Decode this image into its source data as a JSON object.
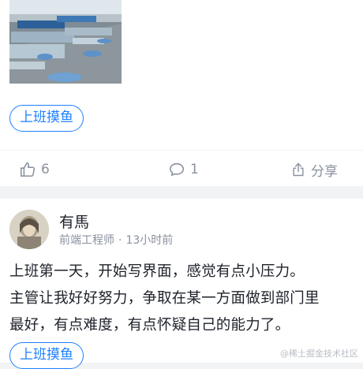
{
  "post1": {
    "tag": "上班摸鱼",
    "likes": "6",
    "comments": "1",
    "share_label": "分享"
  },
  "post2": {
    "author_name": "有馬",
    "author_title": "前端工程师",
    "separator": "·",
    "time": "13小时前",
    "lines": [
      "上班第一天，开始写界面，感觉有点小压力。",
      "主管让我好好努力，争取在某一方面做到部门里",
      "最好，有点难度，有点怀疑自己的能力了。"
    ],
    "tag": "上班摸鱼"
  },
  "watermark": "@稀土掘金技术社区",
  "colors": {
    "accent": "#1e80ff",
    "muted": "#8a919f",
    "text": "#1d2129",
    "bg": "#f2f3f5"
  },
  "icons": [
    "thumbs-up-icon",
    "comment-icon",
    "share-icon"
  ]
}
